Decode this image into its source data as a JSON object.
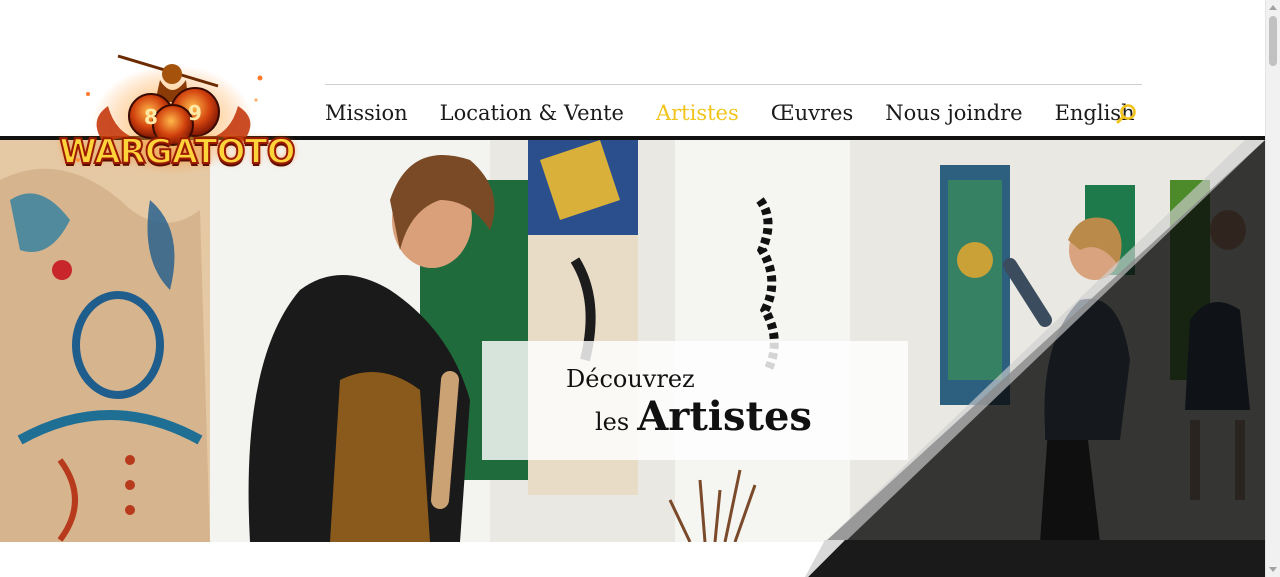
{
  "brand": {
    "logo_text": "WARGATOTO"
  },
  "nav": {
    "items": [
      {
        "label": "Mission",
        "active": false
      },
      {
        "label": "Location & Vente",
        "active": false
      },
      {
        "label": "Artistes",
        "active": true
      },
      {
        "label": "Œuvres",
        "active": false
      },
      {
        "label": "Nous joindre",
        "active": false
      },
      {
        "label": "English",
        "active": false
      }
    ],
    "search_icon": "search-icon"
  },
  "hero": {
    "line1": "Découvrez",
    "line2_small": "les",
    "line2_big": "Artistes"
  },
  "colors": {
    "accent": "#f2c41b",
    "text": "#1a1a1a",
    "dark": "#111111"
  }
}
